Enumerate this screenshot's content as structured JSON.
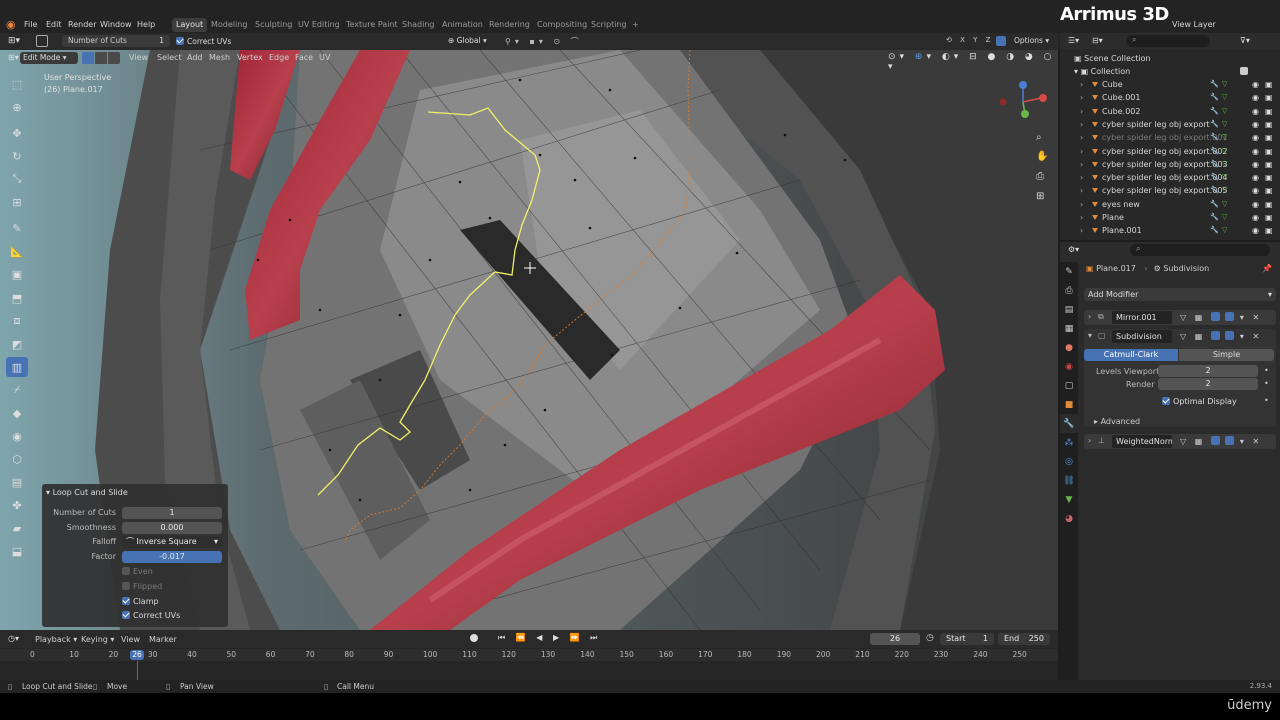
{
  "menu": [
    "File",
    "Edit",
    "Render",
    "Window",
    "Help"
  ],
  "workspaces": [
    "Layout",
    "Modeling",
    "Sculpting",
    "UV Editing",
    "Texture Paint",
    "Shading",
    "Animation",
    "Rendering",
    "Compositing",
    "Scripting"
  ],
  "active_workspace": "Layout",
  "brand": "Arrimus 3D",
  "view_layer": "View Layer",
  "tool_header": {
    "number_of_cuts_label": "Number of Cuts",
    "number_of_cuts_value": "1",
    "correct_uvs": "Correct UVs",
    "orientation": "Global",
    "options": "Options"
  },
  "viewport_header": {
    "mode": "Edit Mode",
    "items": [
      "View",
      "Select",
      "Add",
      "Mesh",
      "Vertex",
      "Edge",
      "Face",
      "UV"
    ]
  },
  "viewport_label": {
    "perspective": "User Perspective",
    "object": "(26) Plane.017"
  },
  "operator_panel": {
    "title": "Loop Cut and Slide",
    "rows": [
      {
        "label": "Number of Cuts",
        "value": "1"
      },
      {
        "label": "Smoothness",
        "value": "0.000"
      },
      {
        "label": "Falloff",
        "value": "Inverse Square"
      },
      {
        "label": "Factor",
        "value": "-0.017"
      }
    ],
    "checks": [
      {
        "label": "Even",
        "checked": false
      },
      {
        "label": "Flipped",
        "checked": false
      },
      {
        "label": "Clamp",
        "checked": true
      },
      {
        "label": "Correct UVs",
        "checked": true
      }
    ]
  },
  "outliner": {
    "scene": "Scene Collection",
    "collection": "Collection",
    "items": [
      {
        "name": "Cube",
        "dim": false
      },
      {
        "name": "Cube.001",
        "dim": false
      },
      {
        "name": "Cube.002",
        "dim": false
      },
      {
        "name": "cyber spider leg obj export",
        "dim": false
      },
      {
        "name": "cyber spider leg obj export.001",
        "dim": true
      },
      {
        "name": "cyber spider leg obj export.002",
        "dim": false
      },
      {
        "name": "cyber spider leg obj export.003",
        "dim": false
      },
      {
        "name": "cyber spider leg obj export.004",
        "dim": false
      },
      {
        "name": "cyber spider leg obj export.005",
        "dim": false
      },
      {
        "name": "eyes new",
        "dim": false
      },
      {
        "name": "Plane",
        "dim": false
      },
      {
        "name": "Plane.001",
        "dim": false
      }
    ]
  },
  "properties": {
    "object": "Plane.017",
    "modifier_context": "Subdivision",
    "add_modifier": "Add Modifier",
    "modifiers": [
      "Mirror.001",
      "Subdivision",
      "WeightedNormal"
    ],
    "subdiv_types": [
      "Catmull-Clark",
      "Simple"
    ],
    "levels_viewport_label": "Levels Viewport",
    "levels_viewport": "2",
    "render_label": "Render",
    "render": "2",
    "optimal_display": "Optimal Display",
    "advanced": "Advanced"
  },
  "timeline": {
    "menus": [
      "Playback",
      "Keying",
      "View",
      "Marker"
    ],
    "current_frame": "26",
    "start_label": "Start",
    "start": "1",
    "end_label": "End",
    "end": "250",
    "ticks": [
      "0",
      "10",
      "20",
      "30",
      "40",
      "50",
      "60",
      "70",
      "80",
      "90",
      "100",
      "110",
      "120",
      "130",
      "140",
      "150",
      "160",
      "170",
      "180",
      "190",
      "200",
      "210",
      "220",
      "230",
      "240",
      "250"
    ]
  },
  "statusbar": {
    "left": "Loop Cut and Slide",
    "move": "Move",
    "pan": "Pan View",
    "call": "Call Menu",
    "version": "2.93.4"
  },
  "watermark": "ūdemy"
}
